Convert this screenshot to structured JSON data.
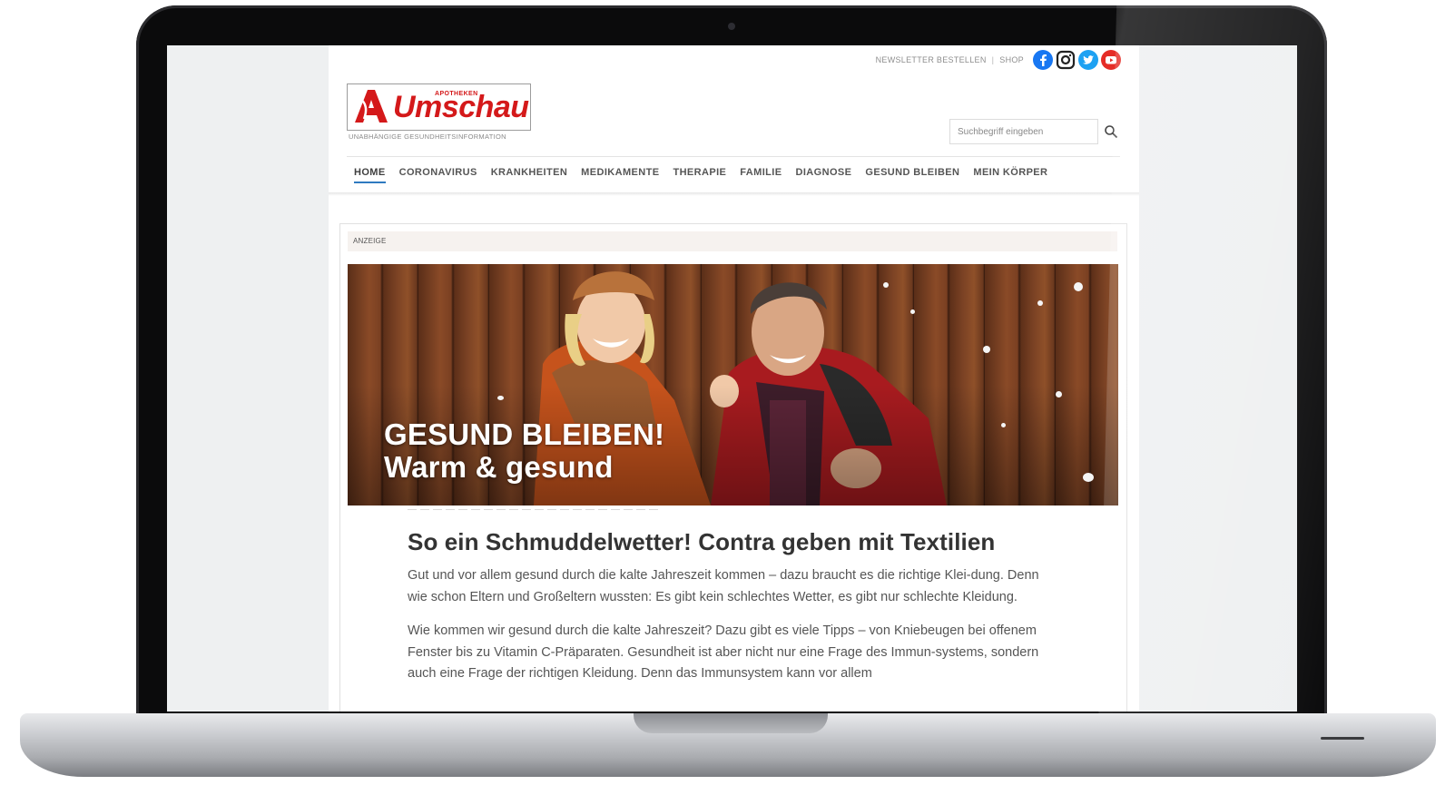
{
  "topbar": {
    "newsletter": "NEWSLETTER BESTELLEN",
    "separator": "|",
    "shop": "SHOP",
    "social": [
      {
        "icon": "facebook-icon",
        "color": "#1877f2"
      },
      {
        "icon": "instagram-icon",
        "color": "#222222"
      },
      {
        "icon": "twitter-icon",
        "color": "#1da1f2"
      },
      {
        "icon": "youtube-icon",
        "color": "#e52d27"
      }
    ]
  },
  "brand": {
    "superscript": "APOTHEKEN",
    "name": "Umschau",
    "tagline": "UNABHÄNGIGE GESUNDHEITSINFORMATION",
    "color": "#d4191a"
  },
  "search": {
    "placeholder": "Suchbegriff eingeben"
  },
  "nav": {
    "items": [
      {
        "label": "HOME",
        "active": true
      },
      {
        "label": "CORONAVIRUS"
      },
      {
        "label": "KRANKHEITEN"
      },
      {
        "label": "MEDIKAMENTE"
      },
      {
        "label": "THERAPIE"
      },
      {
        "label": "FAMILIE"
      },
      {
        "label": "DIAGNOSE"
      },
      {
        "label": "GESUND BLEIBEN"
      },
      {
        "label": "MEIN KÖRPER"
      }
    ],
    "accent": "#2f7ac0"
  },
  "ad": {
    "label": "ANZEIGE",
    "hero_line1": "GESUND BLEIBEN!",
    "hero_line2": "Warm & gesund"
  },
  "article": {
    "title": "So ein Schmuddelwetter! Contra geben mit Textilien",
    "paragraphs": [
      "Gut und vor allem gesund durch die kalte Jahreszeit kommen – dazu braucht es die richtige Klei-dung. Denn wie schon Eltern und Großeltern wussten: Es gibt kein schlechtes Wetter, es gibt nur schlechte Kleidung.",
      "Wie kommen wir gesund durch die kalte Jahreszeit? Dazu gibt es viele Tipps – von Kniebeugen bei offenem Fenster bis zu Vitamin C-Präparaten. Gesundheit ist aber nicht nur eine Frage des Immun-systems, sondern auch eine Frage der richtigen Kleidung. Denn das Immunsystem kann vor allem"
    ]
  }
}
